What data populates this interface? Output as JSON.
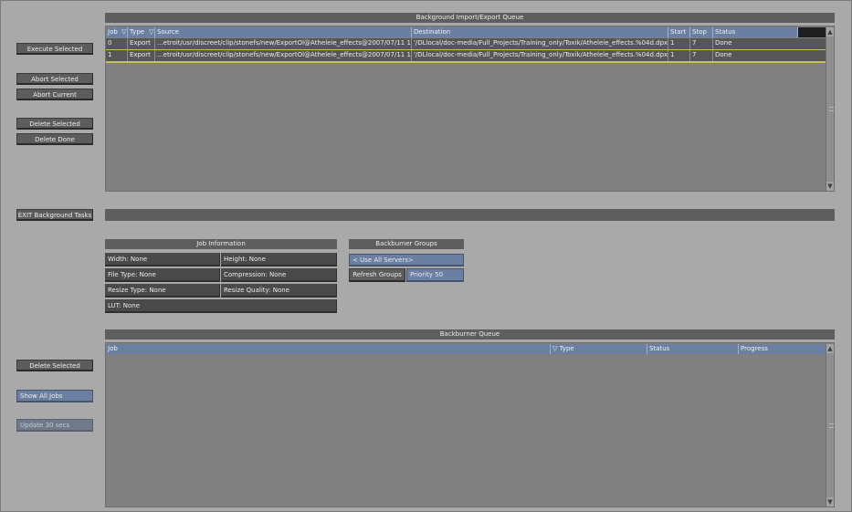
{
  "left_buttons": {
    "execute_selected": "Execute Selected",
    "abort_selected": "Abort Selected",
    "abort_current": "Abort Current",
    "delete_selected": "Delete Selected",
    "delete_done": "Delete Done",
    "exit_background_tasks": "EXIT Background Tasks",
    "delete_selected_bb": "Delete Selected",
    "show_all_jobs": "Show All Jobs",
    "update": "Update 30 secs"
  },
  "import_export_queue": {
    "title": "Background Import/Export Queue",
    "columns": [
      "Job",
      "Type",
      "Source",
      "Destination",
      "Start",
      "Stop",
      "Status"
    ],
    "sort_arrow": "▽",
    "rows": [
      {
        "job": "0",
        "type": "Export",
        "source": "...etroit/usr/discreet/clip/stonefs/new/ExportOl@Atheleie_effects@2007/07/11 13:42:11'",
        "destination": "'/DLlocal/doc-media/Full_Projects/Training_only/Toxik/Atheleie_effects.%04d.dpx'",
        "start": "1",
        "stop": "7",
        "status": "Done"
      },
      {
        "job": "1",
        "type": "Export",
        "source": "...etroit/usr/discreet/clip/stonefs/new/ExportOl@Atheleie_effects@2007/07/11 13:42:29'",
        "destination": "'/DLlocal/doc-media/Full_Projects/Training_only/Toxik/Atheleie_effects.%04d.dpx'",
        "start": "1",
        "stop": "7",
        "status": "Done"
      }
    ]
  },
  "job_information": {
    "title": "Job Information",
    "width": "Width: None",
    "height": "Height: None",
    "file_type": "File Type: None",
    "compression": "Compression: None",
    "resize_type": "Resize Type: None",
    "resize_quality": "Resize Quality: None",
    "lut": "LUT: None"
  },
  "backburner_groups": {
    "title": "Backburner Groups",
    "server_select": "< Use All Servers>",
    "refresh_groups": "Refresh Groups",
    "priority": "Priority 50"
  },
  "backburner_queue": {
    "title": "Backburner Queue",
    "columns": [
      "Job",
      "Type",
      "Status",
      "Progress"
    ],
    "sort_arrow": "▽"
  },
  "scroll": {
    "up": "▲",
    "down": "▼"
  },
  "colors": {
    "background": "#a9a9a9",
    "header_blue": "#6a7fa2",
    "row_separator": "#c4c25a",
    "button_dark": "#5c5c5c"
  }
}
